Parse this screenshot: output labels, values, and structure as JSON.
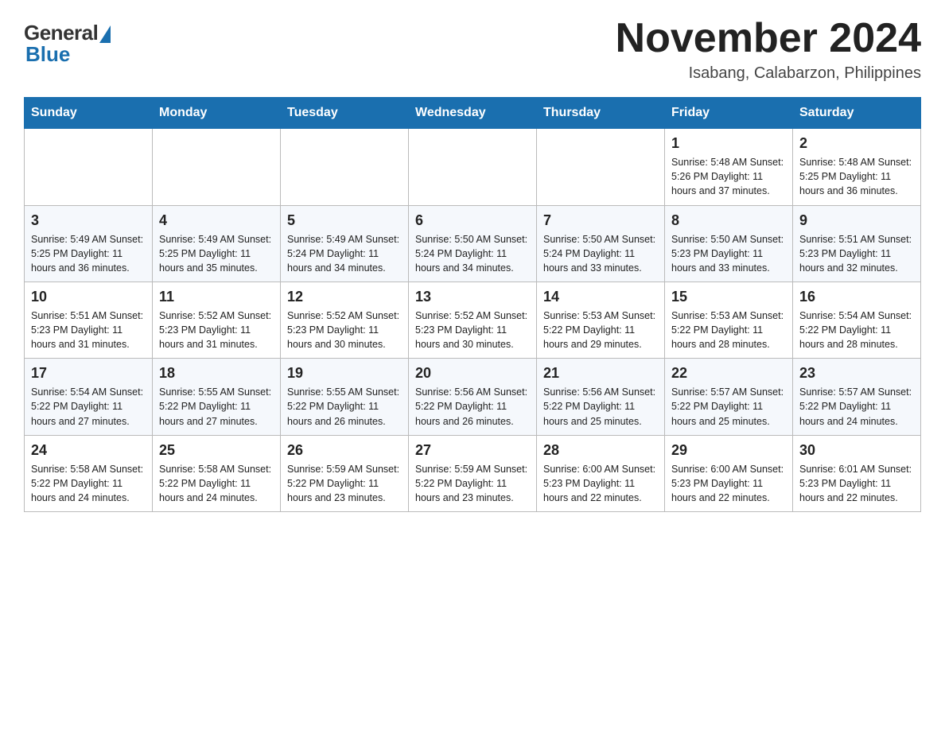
{
  "header": {
    "logo_general": "General",
    "logo_blue": "Blue",
    "month_title": "November 2024",
    "location": "Isabang, Calabarzon, Philippines"
  },
  "calendar": {
    "days_of_week": [
      "Sunday",
      "Monday",
      "Tuesday",
      "Wednesday",
      "Thursday",
      "Friday",
      "Saturday"
    ],
    "weeks": [
      {
        "days": [
          {
            "num": "",
            "info": ""
          },
          {
            "num": "",
            "info": ""
          },
          {
            "num": "",
            "info": ""
          },
          {
            "num": "",
            "info": ""
          },
          {
            "num": "",
            "info": ""
          },
          {
            "num": "1",
            "info": "Sunrise: 5:48 AM\nSunset: 5:26 PM\nDaylight: 11 hours and 37 minutes."
          },
          {
            "num": "2",
            "info": "Sunrise: 5:48 AM\nSunset: 5:25 PM\nDaylight: 11 hours and 36 minutes."
          }
        ]
      },
      {
        "days": [
          {
            "num": "3",
            "info": "Sunrise: 5:49 AM\nSunset: 5:25 PM\nDaylight: 11 hours and 36 minutes."
          },
          {
            "num": "4",
            "info": "Sunrise: 5:49 AM\nSunset: 5:25 PM\nDaylight: 11 hours and 35 minutes."
          },
          {
            "num": "5",
            "info": "Sunrise: 5:49 AM\nSunset: 5:24 PM\nDaylight: 11 hours and 34 minutes."
          },
          {
            "num": "6",
            "info": "Sunrise: 5:50 AM\nSunset: 5:24 PM\nDaylight: 11 hours and 34 minutes."
          },
          {
            "num": "7",
            "info": "Sunrise: 5:50 AM\nSunset: 5:24 PM\nDaylight: 11 hours and 33 minutes."
          },
          {
            "num": "8",
            "info": "Sunrise: 5:50 AM\nSunset: 5:23 PM\nDaylight: 11 hours and 33 minutes."
          },
          {
            "num": "9",
            "info": "Sunrise: 5:51 AM\nSunset: 5:23 PM\nDaylight: 11 hours and 32 minutes."
          }
        ]
      },
      {
        "days": [
          {
            "num": "10",
            "info": "Sunrise: 5:51 AM\nSunset: 5:23 PM\nDaylight: 11 hours and 31 minutes."
          },
          {
            "num": "11",
            "info": "Sunrise: 5:52 AM\nSunset: 5:23 PM\nDaylight: 11 hours and 31 minutes."
          },
          {
            "num": "12",
            "info": "Sunrise: 5:52 AM\nSunset: 5:23 PM\nDaylight: 11 hours and 30 minutes."
          },
          {
            "num": "13",
            "info": "Sunrise: 5:52 AM\nSunset: 5:23 PM\nDaylight: 11 hours and 30 minutes."
          },
          {
            "num": "14",
            "info": "Sunrise: 5:53 AM\nSunset: 5:22 PM\nDaylight: 11 hours and 29 minutes."
          },
          {
            "num": "15",
            "info": "Sunrise: 5:53 AM\nSunset: 5:22 PM\nDaylight: 11 hours and 28 minutes."
          },
          {
            "num": "16",
            "info": "Sunrise: 5:54 AM\nSunset: 5:22 PM\nDaylight: 11 hours and 28 minutes."
          }
        ]
      },
      {
        "days": [
          {
            "num": "17",
            "info": "Sunrise: 5:54 AM\nSunset: 5:22 PM\nDaylight: 11 hours and 27 minutes."
          },
          {
            "num": "18",
            "info": "Sunrise: 5:55 AM\nSunset: 5:22 PM\nDaylight: 11 hours and 27 minutes."
          },
          {
            "num": "19",
            "info": "Sunrise: 5:55 AM\nSunset: 5:22 PM\nDaylight: 11 hours and 26 minutes."
          },
          {
            "num": "20",
            "info": "Sunrise: 5:56 AM\nSunset: 5:22 PM\nDaylight: 11 hours and 26 minutes."
          },
          {
            "num": "21",
            "info": "Sunrise: 5:56 AM\nSunset: 5:22 PM\nDaylight: 11 hours and 25 minutes."
          },
          {
            "num": "22",
            "info": "Sunrise: 5:57 AM\nSunset: 5:22 PM\nDaylight: 11 hours and 25 minutes."
          },
          {
            "num": "23",
            "info": "Sunrise: 5:57 AM\nSunset: 5:22 PM\nDaylight: 11 hours and 24 minutes."
          }
        ]
      },
      {
        "days": [
          {
            "num": "24",
            "info": "Sunrise: 5:58 AM\nSunset: 5:22 PM\nDaylight: 11 hours and 24 minutes."
          },
          {
            "num": "25",
            "info": "Sunrise: 5:58 AM\nSunset: 5:22 PM\nDaylight: 11 hours and 24 minutes."
          },
          {
            "num": "26",
            "info": "Sunrise: 5:59 AM\nSunset: 5:22 PM\nDaylight: 11 hours and 23 minutes."
          },
          {
            "num": "27",
            "info": "Sunrise: 5:59 AM\nSunset: 5:22 PM\nDaylight: 11 hours and 23 minutes."
          },
          {
            "num": "28",
            "info": "Sunrise: 6:00 AM\nSunset: 5:23 PM\nDaylight: 11 hours and 22 minutes."
          },
          {
            "num": "29",
            "info": "Sunrise: 6:00 AM\nSunset: 5:23 PM\nDaylight: 11 hours and 22 minutes."
          },
          {
            "num": "30",
            "info": "Sunrise: 6:01 AM\nSunset: 5:23 PM\nDaylight: 11 hours and 22 minutes."
          }
        ]
      }
    ]
  }
}
